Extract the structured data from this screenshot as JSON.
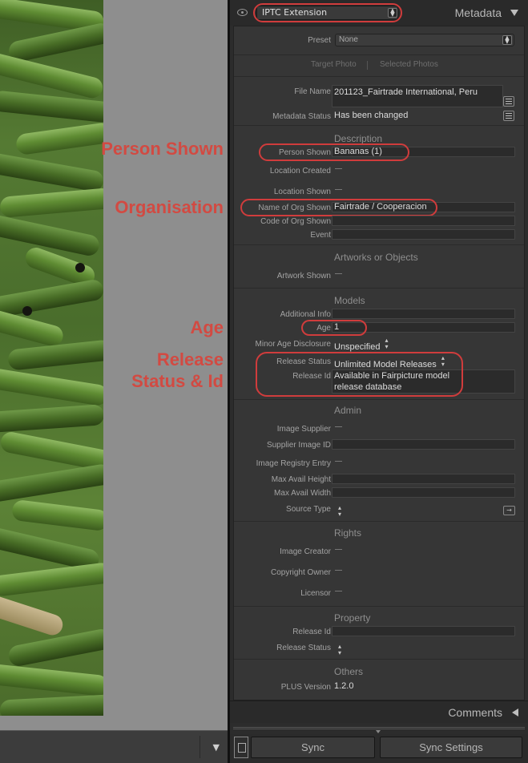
{
  "annotations": {
    "person_shown": "Person Shown",
    "organisation": "Organisation",
    "age": "Age",
    "release_line1": "Release",
    "release_line2": "Status & Id"
  },
  "header": {
    "metadata_set": "IPTC Extension",
    "title": "Metadata"
  },
  "preset": {
    "label": "Preset",
    "value": "None"
  },
  "target": {
    "target_photo": "Target Photo",
    "selected_photos": "Selected Photos"
  },
  "file": {
    "name_label": "File Name",
    "name_value": "201123_Fairtrade International, Peru",
    "status_label": "Metadata Status",
    "status_value": "Has been changed"
  },
  "description": {
    "section": "Description",
    "person_shown_label": "Person Shown",
    "person_shown_value": "Bananas (1)",
    "location_created_label": "Location Created",
    "location_shown_label": "Location Shown",
    "org_name_label": "Name of Org Shown",
    "org_name_value": "Fairtrade / Cooperacion",
    "org_code_label": "Code of Org Shown",
    "event_label": "Event"
  },
  "artworks": {
    "section": "Artworks or Objects",
    "artwork_shown_label": "Artwork Shown"
  },
  "models": {
    "section": "Models",
    "additional_info_label": "Additional Info",
    "age_label": "Age",
    "age_value": "1",
    "minor_label": "Minor Age Disclosure",
    "minor_value": "Unspecified",
    "release_status_label": "Release Status",
    "release_status_value": "Unlimited Model Releases",
    "release_id_label": "Release Id",
    "release_id_line1": "Available in Fairpicture model",
    "release_id_line2": "release database"
  },
  "admin": {
    "section": "Admin",
    "image_supplier_label": "Image Supplier",
    "supplier_image_id_label": "Supplier Image ID",
    "registry_entry_label": "Image Registry Entry",
    "max_height_label": "Max Avail Height",
    "max_width_label": "Max Avail Width",
    "source_type_label": "Source Type"
  },
  "rights": {
    "section": "Rights",
    "image_creator_label": "Image Creator",
    "copyright_owner_label": "Copyright Owner",
    "licensor_label": "Licensor"
  },
  "property": {
    "section": "Property",
    "release_id_label": "Release Id",
    "release_status_label": "Release Status"
  },
  "others": {
    "section": "Others",
    "plus_version_label": "PLUS Version",
    "plus_version_value": "1.2.0"
  },
  "footer": {
    "comments": "Comments",
    "sync": "Sync",
    "sync_settings": "Sync Settings"
  },
  "colors": {
    "annotation": "#d24a42",
    "panel": "#363636",
    "preview_bg": "#8e8e8e"
  }
}
